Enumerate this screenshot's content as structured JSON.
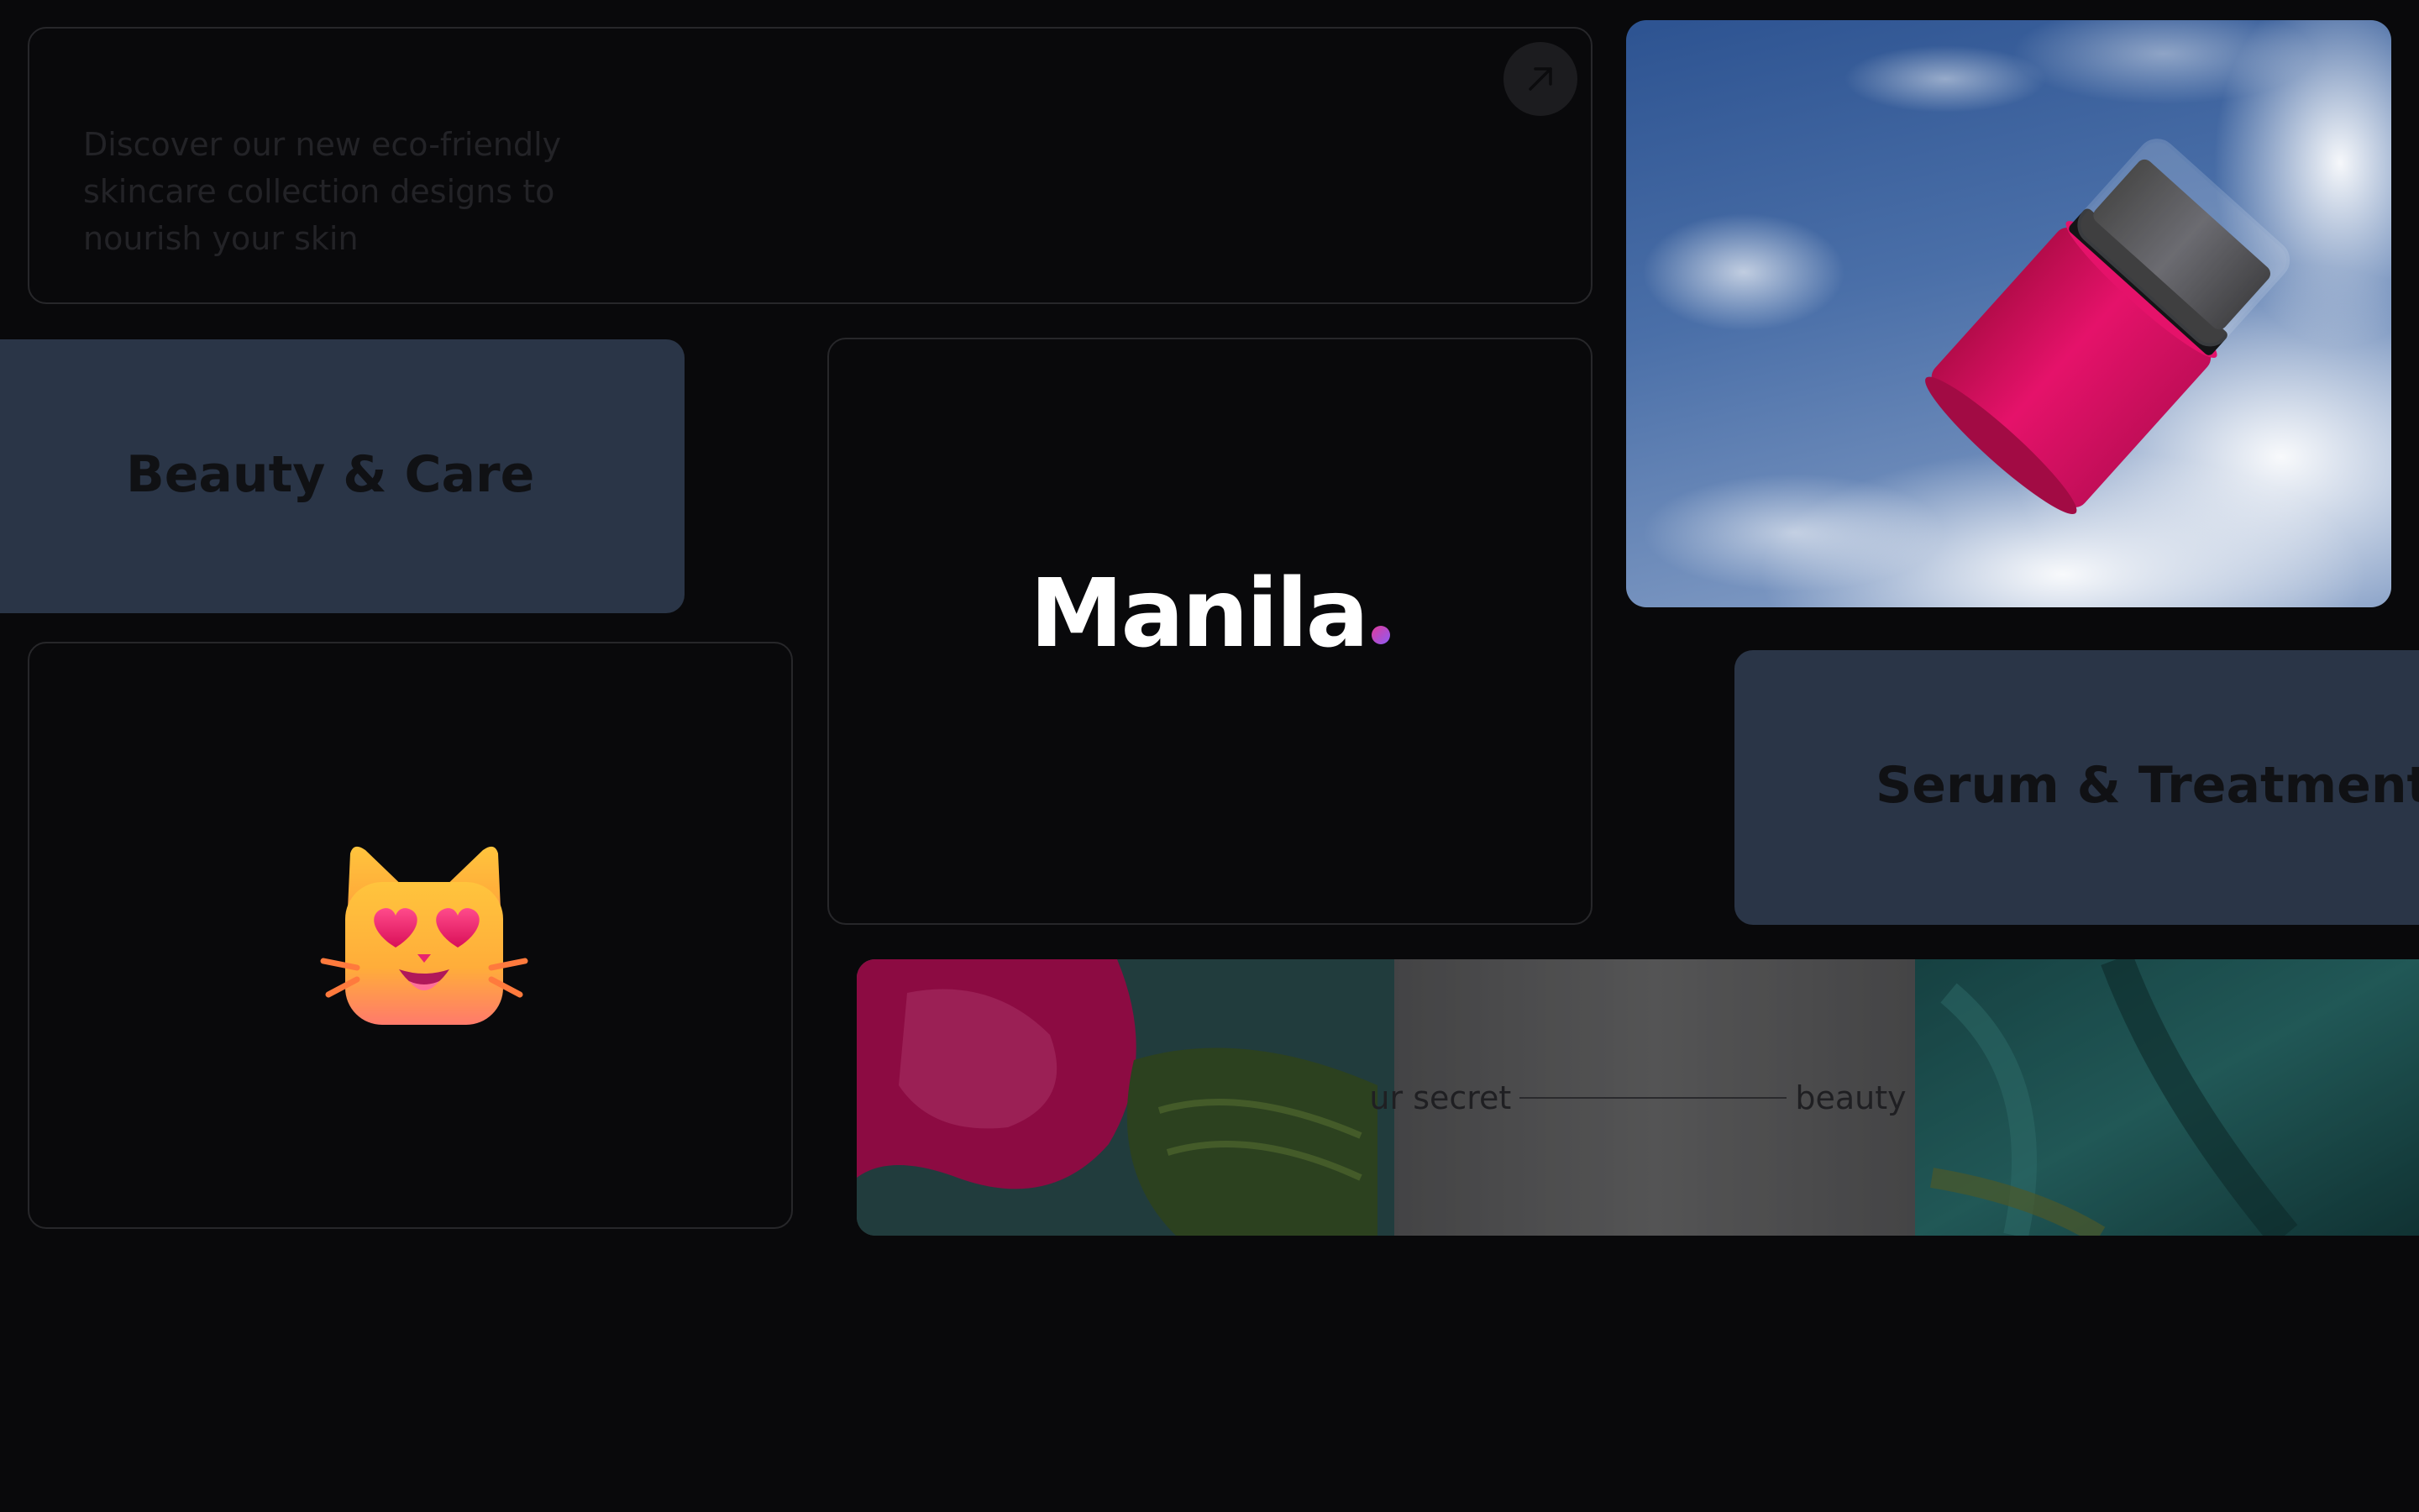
{
  "promo": {
    "text": "Discover our new eco-friendly skincare collection designs to nourish your skin",
    "arrow_icon": "arrow-up-right-icon"
  },
  "categories": {
    "beauty": "Beauty & Care",
    "serum": "Serum & Treatment"
  },
  "brand": {
    "name": "Manila",
    "dot": "."
  },
  "emoji": {
    "icon": "smiling-cat-heart-eyes-icon"
  },
  "banner": {
    "left_text": "ur secret",
    "right_text": "beauty"
  },
  "colors": {
    "background": "#09090b",
    "card_slate": "#2a3547",
    "card_border": "#27272a",
    "brand_dot_from": "#e23b9a",
    "brand_dot_to": "#8b5cf6",
    "product_pink": "#e0105c"
  }
}
